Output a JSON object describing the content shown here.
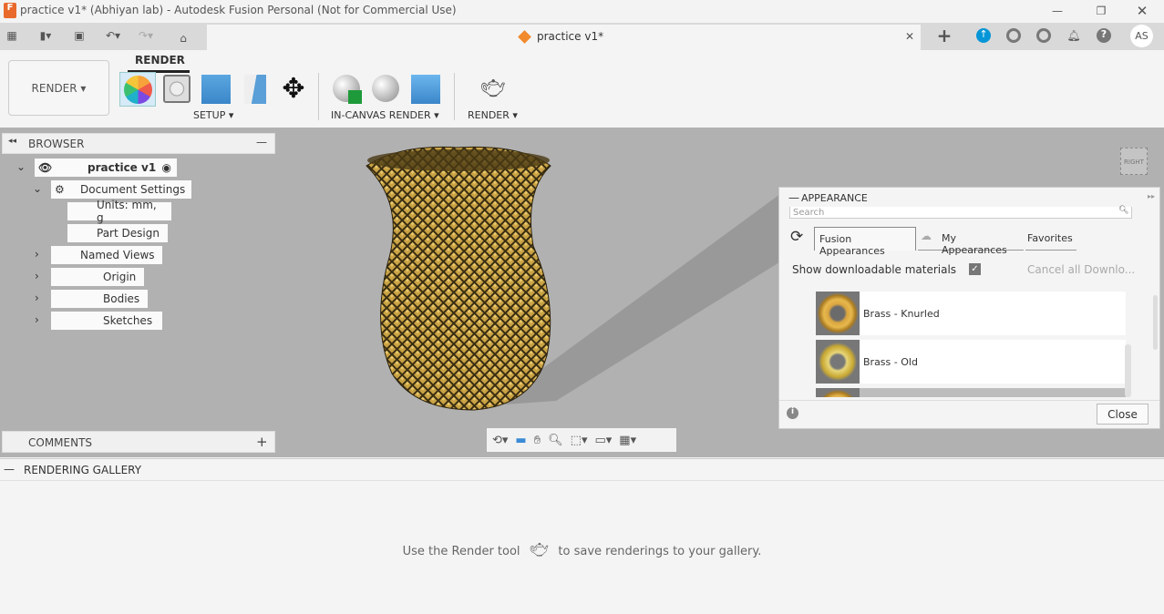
{
  "window": {
    "title": "practice v1* (Abhiyan lab) - Autodesk Fusion Personal (Not for Commercial Use)",
    "app_icon_letter": "F",
    "minimize": "—",
    "restore": "❐",
    "close": "✕"
  },
  "tab": {
    "label": "practice v1*",
    "close": "✕",
    "new": "+",
    "avatar": "AS"
  },
  "toolbar": {
    "workspace": "RENDER",
    "tab_label": "RENDER",
    "groups": [
      {
        "label": "SETUP"
      },
      {
        "label": "IN-CANVAS RENDER"
      },
      {
        "label": "RENDER"
      }
    ]
  },
  "browser": {
    "title": "BROWSER",
    "root": "practice v1",
    "items": [
      {
        "label": "Document Settings"
      },
      {
        "label": "Units: mm, g"
      },
      {
        "label": "Part Design"
      },
      {
        "label": "Named Views"
      },
      {
        "label": "Origin"
      },
      {
        "label": "Bodies"
      },
      {
        "label": "Sketches"
      }
    ]
  },
  "comments": {
    "title": "COMMENTS",
    "add": "+"
  },
  "viewcube": {
    "label": "RIGHT"
  },
  "appearance": {
    "title": "APPEARANCE",
    "search_placeholder": "Search",
    "tabs": [
      "Fusion Appearances",
      "My Appearances",
      "Favorites"
    ],
    "active_tab": "Fusion Appearances",
    "show_downloadable": "Show downloadable materials",
    "show_downloadable_checked": true,
    "cancel_downloads": "Cancel all Downlo...",
    "materials": [
      "Brass - Knurled",
      "Brass - Old"
    ],
    "close": "Close"
  },
  "gallery": {
    "title": "RENDERING GALLERY",
    "hint_before": "Use the Render tool",
    "hint_after": "to save renderings to your gallery."
  },
  "colors": {
    "accent": "#0696d7",
    "gold": "#b8912f",
    "canvas": "#b1b1b1"
  }
}
